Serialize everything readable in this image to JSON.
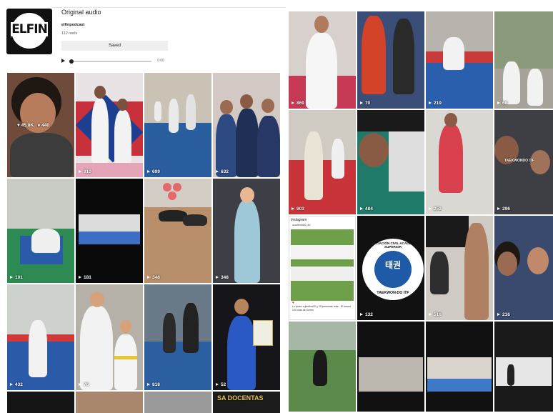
{
  "audio": {
    "title": "Original audio",
    "author": "elfinpodcast",
    "reels": "112 reels",
    "saved_label": "Saved",
    "time": "0:00",
    "logo_text": "ELFIN"
  },
  "left_grid": {
    "rows": [
      [
        "",
        "910",
        "699",
        "632"
      ],
      [
        "101",
        "181",
        "348",
        "348"
      ],
      [
        "432",
        "76",
        "818",
        "52"
      ],
      [
        "",
        "",
        "",
        ""
      ]
    ],
    "overlay": {
      "likes": "45.8K",
      "comments": "440"
    },
    "banner_text": "SA DOCENTAS"
  },
  "right_grid": {
    "rows": [
      [
        "869",
        "70",
        "219",
        "68"
      ],
      [
        "903",
        "484",
        "252",
        "296"
      ],
      [
        "",
        "132",
        "516",
        "216"
      ],
      [
        "",
        "",
        "",
        ""
      ]
    ],
    "ig_card": {
      "brand": "Instagram",
      "user": "academia00_itd",
      "caption": "Lo quiso a jitmthrs02 y 15 personas más · El torneo 100 mas de torneo"
    },
    "badge": {
      "top_text": "ASOCIACIÓN CIVIL ACADEMIA SUPERIOR",
      "bottom_text": "TAEKWON-DO ITF",
      "symbol": "태권"
    },
    "small_caption": "TAEKWONDO ITF"
  }
}
